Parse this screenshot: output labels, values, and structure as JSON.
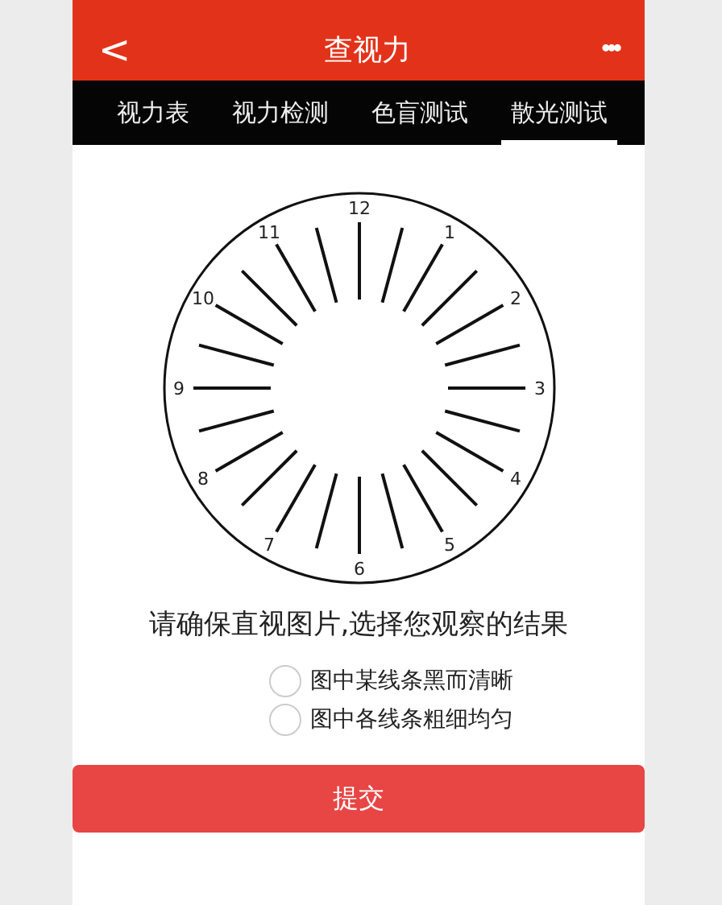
{
  "header": {
    "back": "<",
    "title": "查视力",
    "more": "•••"
  },
  "tabs": [
    {
      "label": "视力表",
      "selected": false
    },
    {
      "label": "视力检测",
      "selected": false
    },
    {
      "label": "色盲测试",
      "selected": false
    },
    {
      "label": "散光测试",
      "selected": true
    }
  ],
  "dial": {
    "numbers": [
      "12",
      "1",
      "2",
      "3",
      "4",
      "5",
      "6",
      "7",
      "8",
      "9",
      "10",
      "11"
    ]
  },
  "instruction": "请确保直视图片,选择您观察的结果",
  "options": [
    {
      "label": "图中某线条黑而清晰",
      "selected": false
    },
    {
      "label": "图中各线条粗细均匀",
      "selected": false
    }
  ],
  "submit": "提交"
}
